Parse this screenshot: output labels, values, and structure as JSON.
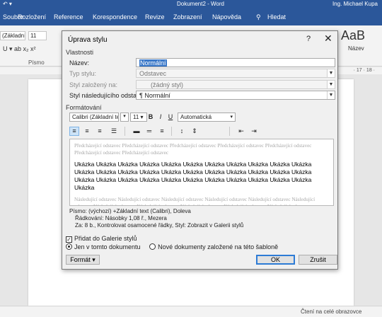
{
  "app": {
    "quick_access": "↶ ▾",
    "window_title": "Dokument2 - Word",
    "user": "Ing. Michael Kupa"
  },
  "menu": [
    "Soubor",
    "Rozložení",
    "Reference",
    "Korespondence",
    "Revize",
    "Zobrazení",
    "Nápověda",
    "Hledat"
  ],
  "ribbon": {
    "font_name": "(Základní",
    "font_size": "11",
    "group_label": "Písmo",
    "style_preview": "AaB",
    "style_name": "Název"
  },
  "ruler": {
    "mark": "· 17 · 18 ·"
  },
  "status": {
    "read_mode": "Čtení na celé obrazovce"
  },
  "dialog": {
    "title": "Úprava stylu",
    "help": "?",
    "close": "✕",
    "section_properties": "Vlastnosti",
    "name_label": "Název:",
    "name_value": "Normální",
    "style_type_label": "Typ stylu:",
    "style_type_value": "Odstavec",
    "based_on_label": "Styl založený na:",
    "based_on_value": "(žádný styl)",
    "next_style_label": "Styl následujícího odstavce:",
    "next_style_value": "¶ Normální",
    "section_format": "Formátování",
    "font_value": "Calibri (Základní te",
    "size_value": "11",
    "color_value": "Automatická",
    "preview_before": "Předcházející odstavec Předcházející odstavec Předcházející odstavec Předcházející odstavec Předcházející odstavec Předcházející odstavec Předcházející odstavec",
    "preview_sample": "Ukázka Ukázka Ukázka Ukázka Ukázka Ukázka Ukázka Ukázka Ukázka Ukázka Ukázka Ukázka Ukázka Ukázka Ukázka Ukázka Ukázka Ukázka Ukázka Ukázka Ukázka Ukázka Ukázka Ukázka Ukázka Ukázka Ukázka Ukázka Ukázka Ukázka Ukázka Ukázka Ukázka Ukázka",
    "preview_after": "Následující odstavec Následující odstavec Následující odstavec Následující odstavec Následující odstavec Následující odstavec Následující odstavec Následující odstavec Následující odstavec Následující odstavec Následující odstavec Následující odstavec Následující odstavec Následující odstavec Následující odstavec",
    "desc_line1": "Písmo: (výchozí) +Základní text (Calibri), Doleva",
    "desc_line2": "Řádkování:  Násobky 1,08 ř., Mezera",
    "desc_line3": "Za:  8 b., Kontrolovat osamocené řádky, Styl: Zobrazit v Galerii stylů",
    "add_to_gallery": "Přidat do Galerie stylů",
    "only_this_doc": "Jen v tomto dokumentu",
    "new_docs": "Nové dokumenty založené na této šabloně",
    "format_button": "Formát ▾",
    "ok_button": "OK",
    "cancel_button": "Zrušit"
  }
}
